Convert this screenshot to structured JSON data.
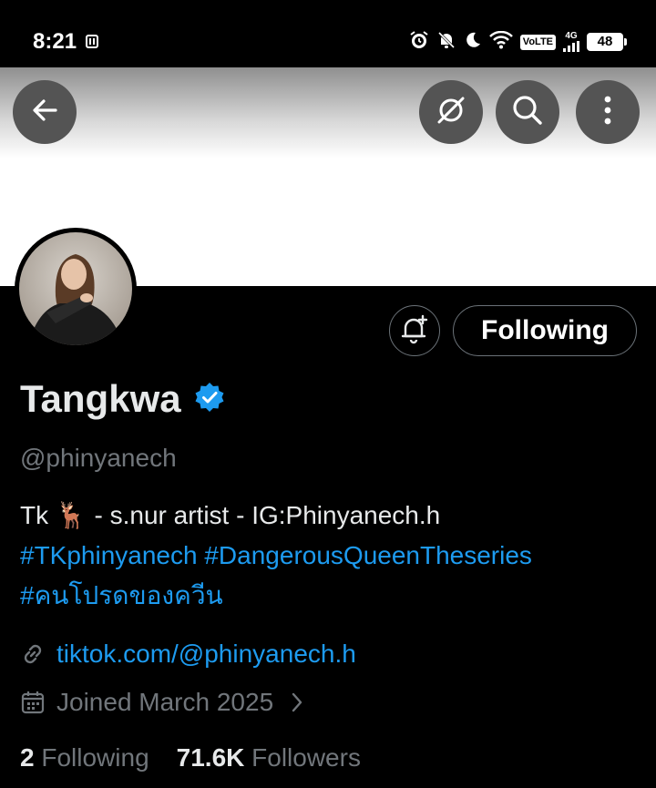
{
  "status_bar": {
    "time": "8:21",
    "volte": "VoLTE",
    "network": "4G",
    "battery": "48",
    "icons": [
      "pager-icon",
      "alarm-icon",
      "bell-off-icon",
      "moon-icon",
      "wifi-icon",
      "signal-icon"
    ]
  },
  "header": {
    "buttons": [
      "back-icon",
      "grok-icon",
      "search-icon",
      "more-vertical-icon"
    ]
  },
  "profile": {
    "display_name": "Tangkwa",
    "handle": "@phinyanech",
    "verified_color": "#1d9bf0",
    "follow_button_label": "Following",
    "bio_text": "Tk 🦌 - s.nur artist - IG:Phinyanech.h",
    "bio_tags": [
      "#TKphinyanech",
      "#DangerousQueenTheseries",
      "#คนโปรดของควีน"
    ],
    "website": "tiktok.com/@phinyanech.h",
    "joined": "Joined March 2025",
    "following_count": "2",
    "following_label": "Following",
    "followers_count": "71.6K",
    "followers_label": "Followers"
  },
  "colors": {
    "accent": "#1d9bf0",
    "muted": "#71767b",
    "background": "#000000"
  }
}
